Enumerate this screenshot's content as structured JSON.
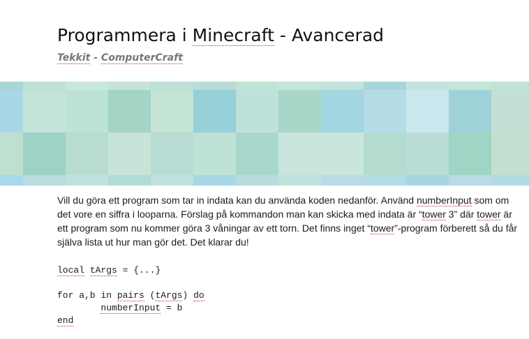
{
  "page": {
    "title_part1": "Programmera i ",
    "title_link": "Minecraft",
    "title_part2": " - Avancerad",
    "subtitle_part1": "Tekkit",
    "subtitle_sep": " - ",
    "subtitle_part2": "ComputerCraft"
  },
  "banner": {
    "colors": [
      [
        "#a8d6d6",
        "#bfe0d4",
        "#c8e8dc",
        "#c6e4d6",
        "#bde0d8",
        "#b8dcd6",
        "#bde4d4",
        "#c4e6da",
        "#bfe2da",
        "#a6d6dc",
        "#c5e2e2",
        "#c4e6d8",
        "#bfe4d6"
      ],
      [
        "#a8d8e6",
        "#c4e4da",
        "#bde2d6",
        "#a4d4c6",
        "#c4e4d6",
        "#96d0d8",
        "#bee2da",
        "#a8d6c8",
        "#a2d6e0",
        "#b4dce4",
        "#c8e8ee",
        "#9fd2d8",
        "#c2e0d6"
      ],
      [
        "#bde0d0",
        "#9ed2c6",
        "#b9dcd0",
        "#c6e4d8",
        "#b8dcd4",
        "#bee2d6",
        "#a8d8cc",
        "#c8e6de",
        "#c8e6de",
        "#b4dcce",
        "#b9dcd4",
        "#a0d4c4",
        "#c2e0d0"
      ],
      [
        "#a8d8ec",
        "#b8dce0",
        "#bfe2dc",
        "#b0dcd8",
        "#bfe2dc",
        "#a8d8e6",
        "#b6dce0",
        "#c0e2dc",
        "#b7dce4",
        "#b4dce4",
        "#a6d6e2",
        "#b8dce2",
        "#b2dae4"
      ]
    ]
  },
  "content": {
    "para_1": "Vill du göra ett program som tar in indata kan du använda koden nedanför. Använd ",
    "para_numberInput": "numberInput",
    "para_2": " som om det vore en siffra i looparna. Förslag på kommandon man kan skicka med indata är “",
    "para_tower1": "tower",
    "para_3": " 3” där ",
    "para_tower2": "tower",
    "para_4": " är ett program som nu kommer göra 3 våningar av ett torn. Det finns inget “",
    "para_tower3": "tower",
    "para_5": "”-program förberett så du får själva lista ut hur man gör det. Det klarar du!"
  },
  "code": {
    "l1_kw": "local",
    "l1_sp": " ",
    "l1_var": "tArgs",
    "l1_rest": " = {...}",
    "l3_a": "for a,b in ",
    "l3_pairs": "pairs",
    "l3_b": " (",
    "l3_targs": "tArgs",
    "l3_c": ") ",
    "l3_do": "do",
    "l4_indent": "        ",
    "l4_var": "numberInput",
    "l4_rest": " = b",
    "l5_end": "end"
  }
}
